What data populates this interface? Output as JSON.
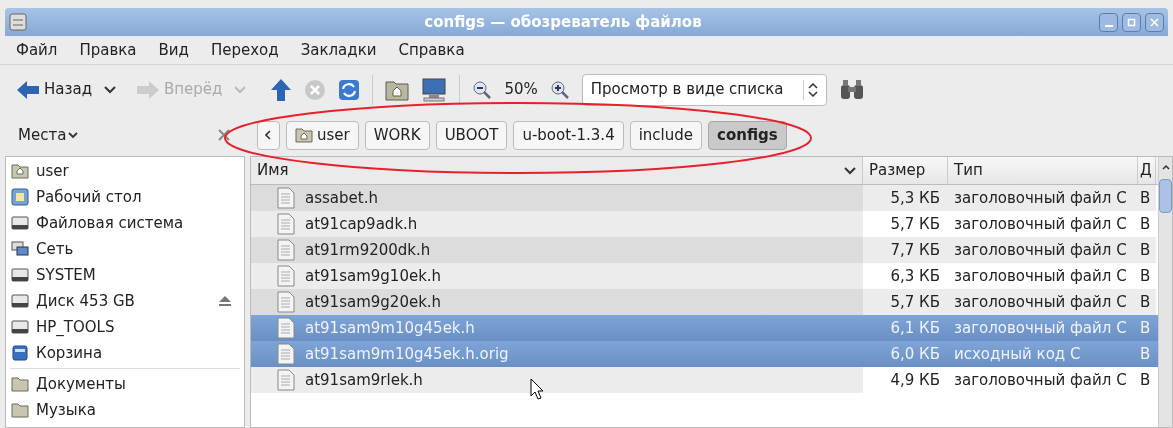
{
  "window": {
    "title": "configs — обозреватель файлов"
  },
  "menu": [
    "Файл",
    "Правка",
    "Вид",
    "Переход",
    "Закладки",
    "Справка"
  ],
  "toolbar": {
    "back": {
      "label": "Назад",
      "disabled": false
    },
    "forward": {
      "label": "Вперёд",
      "disabled": true
    },
    "zoom": "50%",
    "view_mode": "Просмотр в виде списка"
  },
  "sidebar": {
    "title": "Места",
    "items": [
      {
        "label": "user",
        "kind": "home",
        "ejectable": false
      },
      {
        "label": "Рабочий стол",
        "kind": "desktop",
        "ejectable": false
      },
      {
        "label": "Файловая система",
        "kind": "drive",
        "ejectable": false
      },
      {
        "label": "Сеть",
        "kind": "network",
        "ejectable": false
      },
      {
        "label": "SYSTEM",
        "kind": "drive",
        "ejectable": false
      },
      {
        "label": "Диск 453 GB",
        "kind": "drive",
        "ejectable": true
      },
      {
        "label": "HP_TOOLS",
        "kind": "drive",
        "ejectable": false
      },
      {
        "label": "Корзина",
        "kind": "trash",
        "ejectable": false
      }
    ],
    "bookmarks": [
      {
        "label": "Документы",
        "kind": "folder",
        "ejectable": false
      },
      {
        "label": "Музыка",
        "kind": "folder",
        "ejectable": false
      }
    ]
  },
  "path": [
    {
      "label": "user",
      "home": true,
      "selected": false
    },
    {
      "label": "WORK",
      "home": false,
      "selected": false
    },
    {
      "label": "UBOOT",
      "home": false,
      "selected": false
    },
    {
      "label": "u-boot-1.3.4",
      "home": false,
      "selected": false
    },
    {
      "label": "include",
      "home": false,
      "selected": false
    },
    {
      "label": "configs",
      "home": false,
      "selected": true
    }
  ],
  "table": {
    "columns": [
      {
        "label": "Имя",
        "sorted": true
      },
      {
        "label": "Размер",
        "sorted": false
      },
      {
        "label": "Тип",
        "sorted": false
      },
      {
        "label": "Д",
        "sorted": false
      }
    ],
    "rows": [
      {
        "name": "assabet.h",
        "size": "5,3 КБ",
        "type": "заголовочный файл C",
        "column_4": "В",
        "selected": false
      },
      {
        "name": "at91cap9adk.h",
        "size": "5,7 КБ",
        "type": "заголовочный файл C",
        "column_4": "В",
        "selected": false
      },
      {
        "name": "at91rm9200dk.h",
        "size": "7,7 КБ",
        "type": "заголовочный файл C",
        "column_4": "В",
        "selected": false
      },
      {
        "name": "at91sam9g10ek.h",
        "size": "6,3 КБ",
        "type": "заголовочный файл C",
        "column_4": "В",
        "selected": false
      },
      {
        "name": "at91sam9g20ek.h",
        "size": "5,7 КБ",
        "type": "заголовочный файл C",
        "column_4": "В",
        "selected": false
      },
      {
        "name": "at91sam9m10g45ek.h",
        "size": "6,1 КБ",
        "type": "заголовочный файл C",
        "column_4": "В",
        "selected": true
      },
      {
        "name": "at91sam9m10g45ek.h.orig",
        "size": "6,0 КБ",
        "type": "исходный код C",
        "column_4": "В",
        "selected": true
      },
      {
        "name": "at91sam9rlek.h",
        "size": "4,9 КБ",
        "type": "заголовочный файл C",
        "column_4": "В",
        "selected": false
      }
    ]
  }
}
